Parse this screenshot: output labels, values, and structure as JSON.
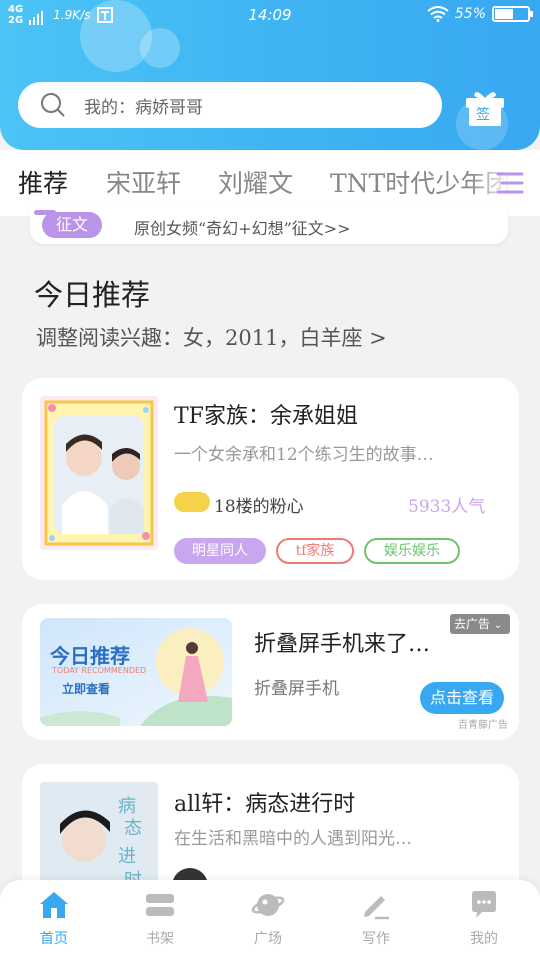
{
  "status_bar": {
    "network_top": "4G",
    "network_bottom": "2G",
    "speed": "1.9K/s",
    "time": "14:09",
    "battery": "55%",
    "battery_level": 0.55
  },
  "search": {
    "placeholder": "我的：病娇哥哥"
  },
  "checkin": {
    "label": "签"
  },
  "tabs": [
    {
      "label": "推荐",
      "active": true
    },
    {
      "label": "宋亚轩",
      "active": false
    },
    {
      "label": "刘耀文",
      "active": false
    },
    {
      "label": "TNT时代少年团",
      "active": false
    }
  ],
  "notice": {
    "tag": "征文",
    "text": "原创女频“奇幻+幻想”征文>>"
  },
  "today": {
    "title": "今日推荐",
    "subtitle": "调整阅读兴趣：女，2011，白羊座 >"
  },
  "books": [
    {
      "title": "TF家族：余承姐姐",
      "desc": "一个女余承和12个练习生的故事…",
      "meta": "18楼的粉心",
      "popularity": "5933人气",
      "tags": [
        "明星同人",
        "tf家族",
        "娱乐娱乐"
      ]
    },
    {
      "title": "all轩：病态进行时",
      "desc": "在生活和黑暗中的人遇到阳光…"
    }
  ],
  "ad": {
    "badge": "去广告",
    "banner_title": "今日推荐",
    "banner_sub": "TODAY RECOMMENDED",
    "banner_btn": "立即查看",
    "title": "折叠屏手机来了…",
    "desc": "折叠屏手机",
    "button": "点击查看",
    "source": "百青藤广告"
  },
  "bottom_nav": [
    {
      "label": "首页",
      "icon": "home-icon",
      "active": true
    },
    {
      "label": "书架",
      "icon": "bookshelf-icon",
      "active": false
    },
    {
      "label": "广场",
      "icon": "planet-icon",
      "active": false
    },
    {
      "label": "写作",
      "icon": "pen-icon",
      "active": false
    },
    {
      "label": "我的",
      "icon": "chat-bubble-icon",
      "active": false
    }
  ],
  "colors": {
    "header": "#3fb3f3",
    "accent": "#38a8f1",
    "purple": "#b994e8",
    "tag_red": "#ef7b74",
    "tag_green": "#6cc56e"
  }
}
